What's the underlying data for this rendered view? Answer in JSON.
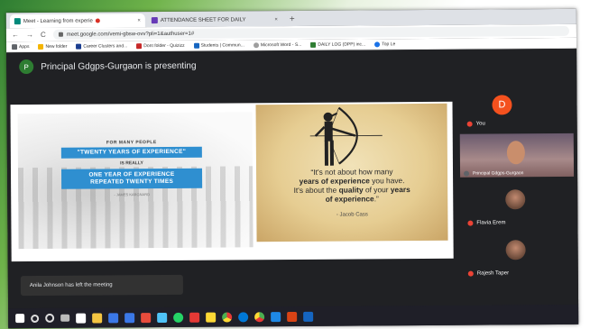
{
  "browser": {
    "tabs": [
      {
        "label": "Meet - Learning from experie",
        "icon_color": "#00897b",
        "recording": true,
        "close": "×"
      },
      {
        "label": "ATTENDANCE SHEET FOR DAILY",
        "icon_color": "#673ab7",
        "recording": false,
        "close": "×"
      }
    ],
    "new_tab": "+",
    "nav": {
      "back": "←",
      "forward": "→",
      "reload": "C"
    },
    "url": "meet.google.com/vemi-gbsw-ovv?pli=1&authuser=1#",
    "bookmarks": [
      {
        "label": "Apps",
        "color": "#5f6368"
      },
      {
        "label": "New folder",
        "color": "#f4b400"
      },
      {
        "label": "Career Clusters and...",
        "color": "#1a3d8f"
      },
      {
        "label": "Dont folder - Quizizz",
        "color": "#c62828"
      },
      {
        "label": "Students | Commun...",
        "color": "#1565c0"
      },
      {
        "label": "Microsoft Word - S...",
        "color": "#9e9e9e"
      },
      {
        "label": "DAILY LOG (DPP) inc...",
        "color": "#2e7d32"
      },
      {
        "label": "Top Le",
        "color": "#1a73e8"
      }
    ]
  },
  "meet": {
    "presenter_initial": "P",
    "presenter_text": "Principal Gdgps-Gurgaon is presenting",
    "slide": {
      "left_panel": {
        "line1": "FOR MANY PEOPLE",
        "line2": "\"TWENTY YEARS OF EXPERIENCE\"",
        "line3": "IS REALLY",
        "line4a": "ONE YEAR OF EXPERIENCE",
        "line4b": "REPEATED TWENTY TIMES",
        "line5": "- JAMES KARGNARD"
      },
      "right_panel": {
        "quote_line1": "“It's not about how many",
        "quote_line2a": "years of experience",
        "quote_line2b": " you have.",
        "quote_line3a": "It's about the ",
        "quote_line3b": "quality",
        "quote_line3c": " of your ",
        "quote_line3d": "years",
        "quote_line4a": "of experience",
        "quote_line4b": ".”",
        "author": "- Jacob Cass"
      }
    },
    "participants": [
      {
        "name": "You",
        "initial": "D",
        "avatar_color": "#f4511e"
      },
      {
        "name": "Principal Gdgps-Gurgaon"
      },
      {
        "name": "Flavia Erem"
      },
      {
        "name": "Rajesh Taper"
      }
    ],
    "toast": "Anila Johnson has left the meeting"
  },
  "taskbar": {
    "icons": [
      {
        "name": "windows",
        "color": "#ffffff"
      },
      {
        "name": "search",
        "color": "#dddddd"
      },
      {
        "name": "cortana",
        "color": "#dddddd"
      },
      {
        "name": "task-view",
        "color": "#dddddd"
      },
      {
        "name": "store",
        "color": "#ffffff"
      },
      {
        "name": "file-explorer",
        "color": "#f4c542"
      },
      {
        "name": "mail",
        "color": "#3b78e7"
      },
      {
        "name": "photos",
        "color": "#3b78e7"
      },
      {
        "name": "office",
        "color": "#e74c3c"
      },
      {
        "name": "weather",
        "color": "#4fc3f7"
      },
      {
        "name": "whatsapp",
        "color": "#25d366"
      },
      {
        "name": "calendar",
        "color": "#e53935"
      },
      {
        "name": "notes",
        "color": "#fdd835"
      },
      {
        "name": "chrome",
        "color": "#e53935"
      },
      {
        "name": "edge",
        "color": "#0078d7"
      },
      {
        "name": "chrome2",
        "color": "#4caf50"
      },
      {
        "name": "movies",
        "color": "#1e88e5"
      },
      {
        "name": "powerpoint",
        "color": "#d84315"
      },
      {
        "name": "word",
        "color": "#1565c0"
      }
    ]
  }
}
